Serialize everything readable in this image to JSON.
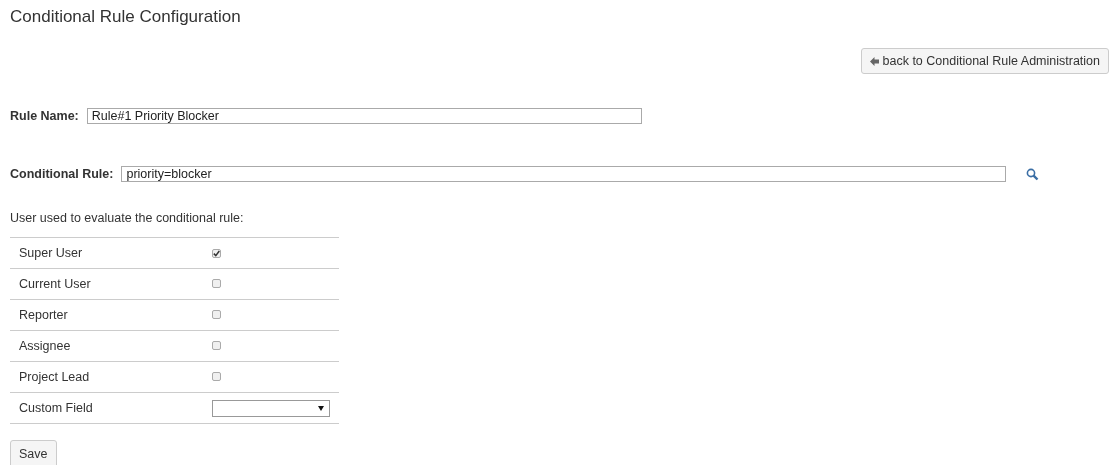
{
  "page_title": "Conditional Rule Configuration",
  "back_button": {
    "label": "back to Conditional Rule Administration"
  },
  "rule_name": {
    "label": "Rule Name:",
    "value": "Rule#1 Priority Blocker"
  },
  "conditional_rule": {
    "label": "Conditional Rule:",
    "value": "priority=blocker"
  },
  "users_heading": "User used to evaluate the conditional rule:",
  "users": [
    {
      "label": "Super User",
      "kind": "checkbox",
      "checked": true
    },
    {
      "label": "Current User",
      "kind": "checkbox",
      "checked": false
    },
    {
      "label": "Reporter",
      "kind": "checkbox",
      "checked": false
    },
    {
      "label": "Assignee",
      "kind": "checkbox",
      "checked": false
    },
    {
      "label": "Project Lead",
      "kind": "checkbox",
      "checked": false
    },
    {
      "label": "Custom Field",
      "kind": "select"
    }
  ],
  "save_button": {
    "label": "Save"
  }
}
